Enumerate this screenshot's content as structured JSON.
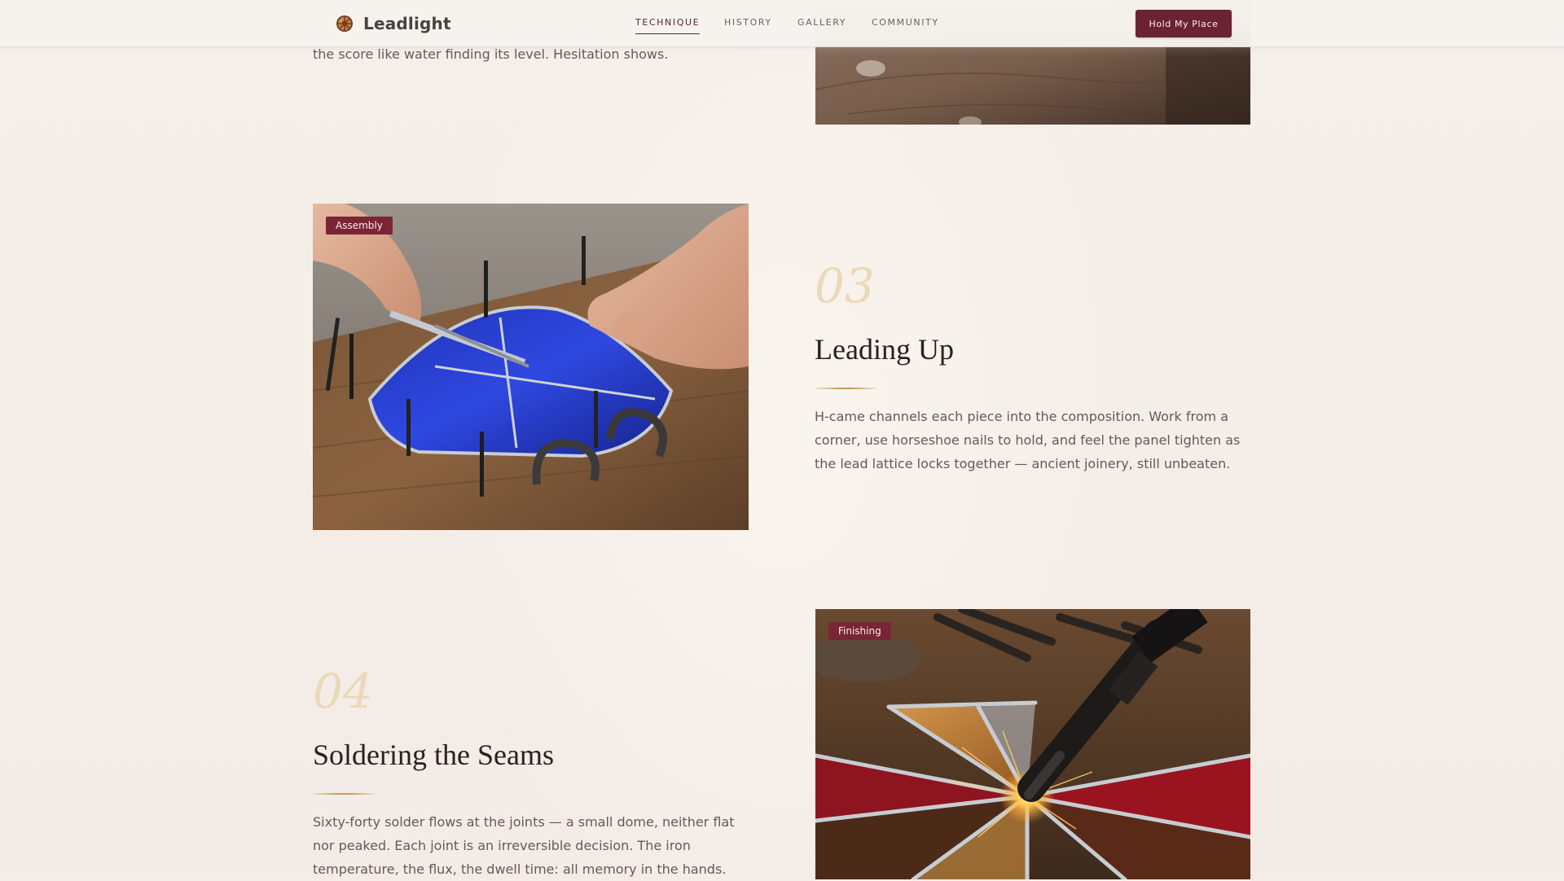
{
  "brand": {
    "name": "Leadlight",
    "logo_icon": "rose-window-icon"
  },
  "nav": {
    "items": [
      {
        "label": "TECHNIQUE",
        "active": true
      },
      {
        "label": "HISTORY",
        "active": false
      },
      {
        "label": "GALLERY",
        "active": false
      },
      {
        "label": "COMMUNITY",
        "active": false
      }
    ]
  },
  "cta": {
    "label": "Hold My Place"
  },
  "previous_section": {
    "body_tail": "the score like water finding its level. Hesitation shows."
  },
  "steps": [
    {
      "number": "03",
      "title": "Leading Up",
      "tag": "Assembly",
      "body": "H-came channels each piece into the composition. Work from a corner, use horseshoe nails to hold, and feel the panel tighten as the lead lattice locks together — ancient joinery, still unbeaten."
    },
    {
      "number": "04",
      "title": "Soldering the Seams",
      "tag": "Finishing",
      "body": "Sixty-forty solder flows at the joints — a small dome, neither flat nor peaked. Each joint is an irreversible decision. The iron temperature, the flux, the dwell time: all memory in the hands."
    }
  ],
  "colors": {
    "accent": "#6b2233",
    "tag": "#7a2536",
    "gold_rule": "#c49a57",
    "step_number": "#ead9b8",
    "background": "#f4eee8"
  }
}
